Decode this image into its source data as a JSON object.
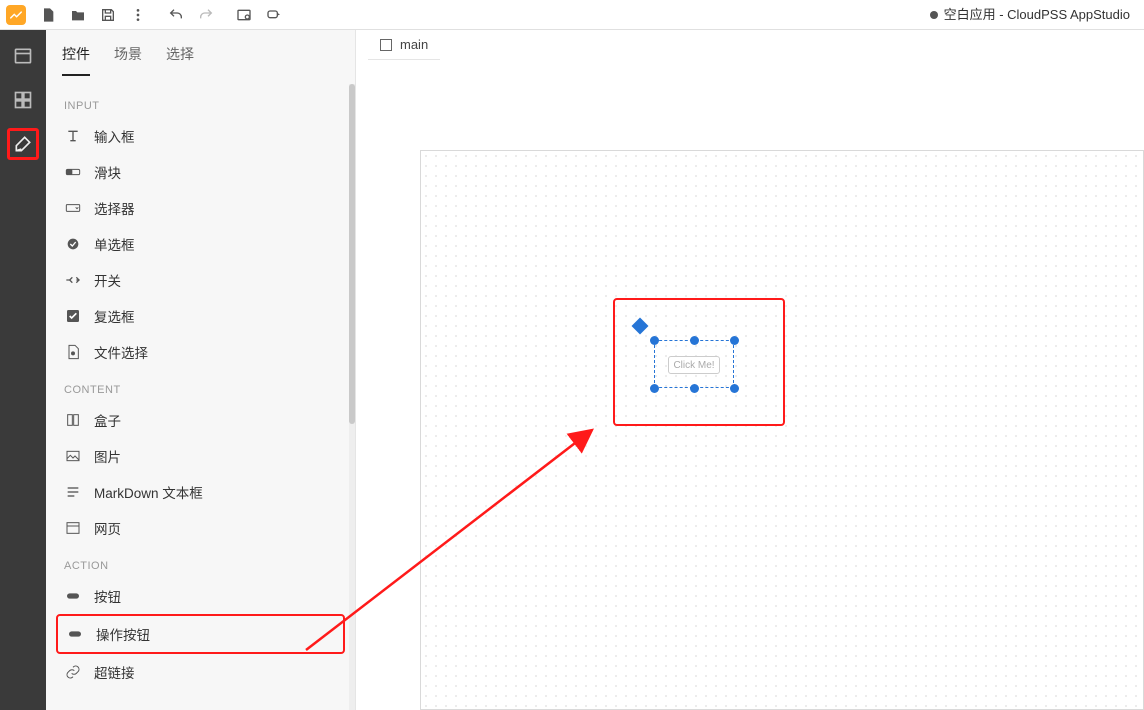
{
  "app_title": "空白应用 - CloudPSS AppStudio",
  "canvas_tab": "main",
  "panel_tabs": [
    "控件",
    "场景",
    "选择"
  ],
  "panel_active_tab": "控件",
  "sections": {
    "input": {
      "header": "INPUT",
      "items": [
        {
          "id": "input-text",
          "label": "输入框",
          "icon": "text-field-icon"
        },
        {
          "id": "slider",
          "label": "滑块",
          "icon": "slider-icon"
        },
        {
          "id": "selector",
          "label": "选择器",
          "icon": "dropdown-icon"
        },
        {
          "id": "radio",
          "label": "单选框",
          "icon": "radio-icon"
        },
        {
          "id": "switch",
          "label": "开关",
          "icon": "switch-icon"
        },
        {
          "id": "checkbox",
          "label": "复选框",
          "icon": "checkbox-icon"
        },
        {
          "id": "file",
          "label": "文件选择",
          "icon": "file-icon"
        }
      ]
    },
    "content": {
      "header": "CONTENT",
      "items": [
        {
          "id": "box",
          "label": "盒子",
          "icon": "box-icon"
        },
        {
          "id": "image",
          "label": "图片",
          "icon": "image-icon"
        },
        {
          "id": "markdown",
          "label": "MarkDown 文本框",
          "icon": "markdown-icon"
        },
        {
          "id": "webpage",
          "label": "网页",
          "icon": "webpage-icon"
        }
      ]
    },
    "action": {
      "header": "ACTION",
      "items": [
        {
          "id": "button",
          "label": "按钮",
          "icon": "button-icon"
        },
        {
          "id": "action-button",
          "label": "操作按钮",
          "icon": "action-button-icon"
        },
        {
          "id": "hyperlink",
          "label": "超链接",
          "icon": "link-icon"
        }
      ]
    }
  },
  "canvas_widget": {
    "label": "Click Me!"
  },
  "annotations": {
    "activity_highlight": true,
    "action_button_highlight": true,
    "canvas_highlight": true
  },
  "colors": {
    "highlight": "#ff1a1a",
    "selection": "#2675d6",
    "logo_bg": "#ffa726"
  }
}
